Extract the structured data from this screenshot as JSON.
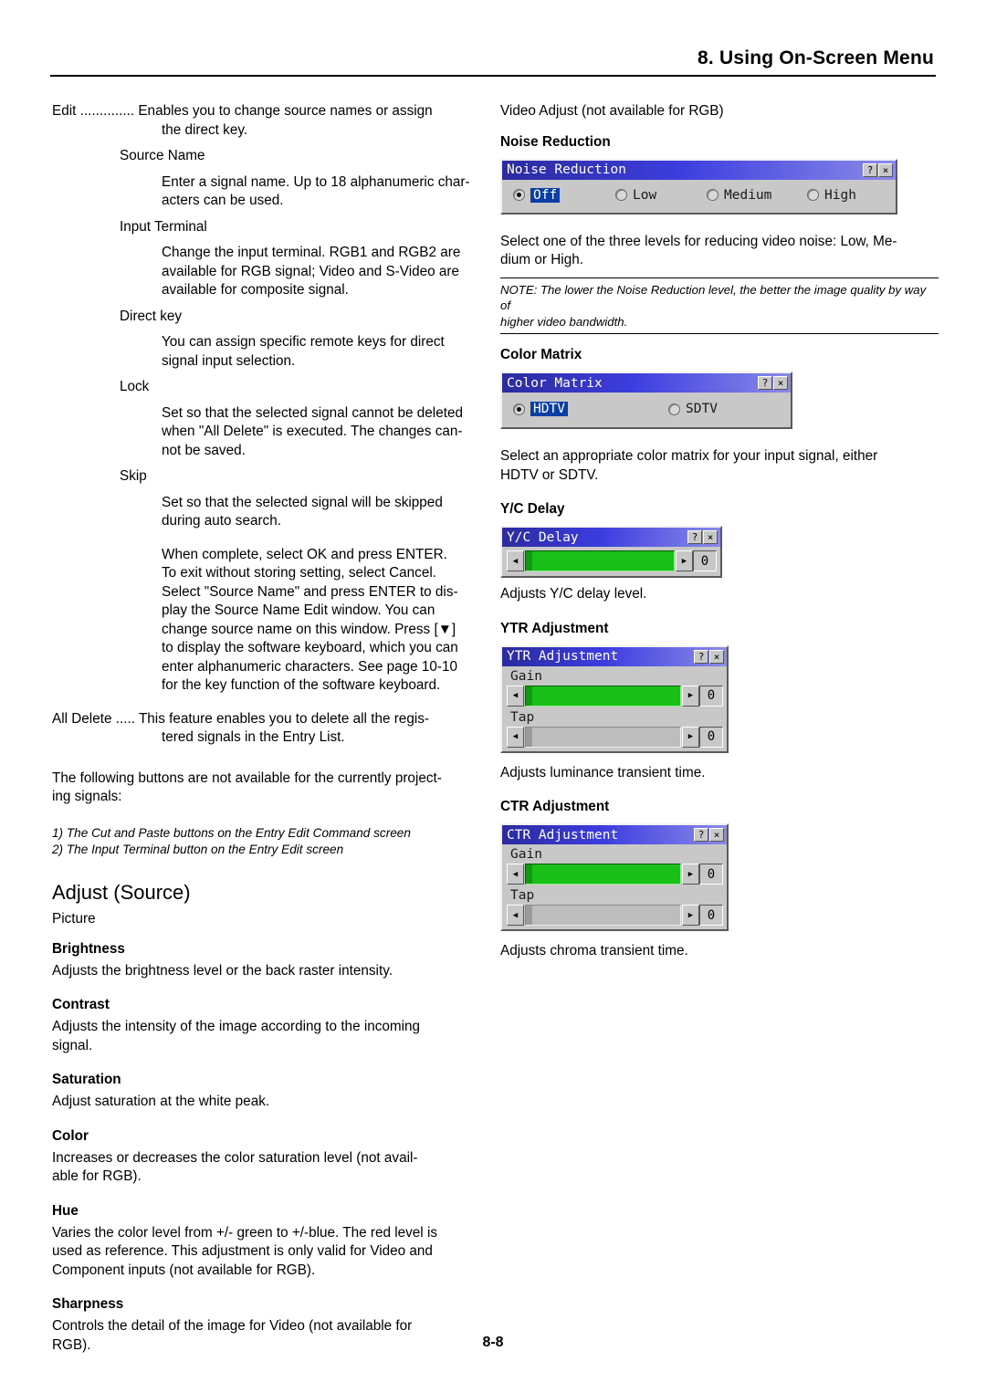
{
  "header": {
    "title": "8. Using On-Screen Menu"
  },
  "footer": {
    "page_number": "8-8"
  },
  "left": {
    "edit_label": "Edit .............. Enables you to change source names or assign",
    "edit_label_2": "the direct key.",
    "source_name_head": "Source Name",
    "source_name_body_1": "Enter a signal name. Up to 18 alphanumeric char-",
    "source_name_body_2": "acters can be used.",
    "input_terminal_head": "Input Terminal",
    "input_terminal_body_1": "Change the input terminal. RGB1 and RGB2 are",
    "input_terminal_body_2": "available for RGB signal; Video and S-Video are",
    "input_terminal_body_3": "available for composite signal.",
    "direct_key_head": "Direct key",
    "direct_key_body_1": "You can assign specific remote keys for direct",
    "direct_key_body_2": "signal input selection.",
    "lock_head": "Lock",
    "lock_body_1": "Set so that the selected signal cannot be deleted",
    "lock_body_2": "when \"All Delete\" is executed. The changes can-",
    "lock_body_3": "not be saved.",
    "skip_head": "Skip",
    "skip_body_1": "Set so that the selected signal will be skipped",
    "skip_body_2": "during auto search.",
    "complete_1": "When complete, select OK and press ENTER.",
    "complete_2": "To exit without storing setting, select Cancel.",
    "complete_3": "Select \"Source Name\" and press ENTER to dis-",
    "complete_4": "play the Source Name Edit window. You can",
    "complete_5": "change source name on this window. Press [▼]",
    "complete_6": "to display the software keyboard, which you can",
    "complete_7": "enter alphanumeric characters. See page 10-10",
    "complete_8": "for the key function of the software keyboard.",
    "all_delete_1": "All Delete ..... This feature enables you to delete all the regis-",
    "all_delete_2": "tered signals in the Entry List.",
    "not_available_1": "The following buttons are not available for the currently project-",
    "not_available_2": "ing signals:",
    "note_1": "1) The Cut and Paste buttons on the Entry Edit Command screen",
    "note_2": "2) The Input Terminal button on the Entry Edit screen",
    "adjust_source_heading": "Adjust (Source)",
    "picture_label": "Picture",
    "items": [
      {
        "title": "Brightness",
        "lines": [
          "Adjusts the brightness level or the back raster intensity."
        ]
      },
      {
        "title": "Contrast",
        "lines": [
          "Adjusts the intensity of the image according to the incoming",
          "signal."
        ]
      },
      {
        "title": "Saturation",
        "lines": [
          "Adjust saturation at the white peak."
        ]
      },
      {
        "title": "Color",
        "lines": [
          "Increases or decreases the color saturation level (not avail-",
          "able for RGB)."
        ]
      },
      {
        "title": "Hue",
        "lines": [
          "Varies the color level from +/- green to +/-blue. The red level is",
          "used as reference. This adjustment is only valid for Video and",
          "Component inputs (not available for RGB)."
        ]
      },
      {
        "title": "Sharpness",
        "lines": [
          "Controls the detail of the image for Video (not available for",
          "RGB)."
        ]
      }
    ]
  },
  "right": {
    "video_adjust_label": "Video Adjust (not available for RGB)",
    "noise_reduction": {
      "heading": "Noise Reduction",
      "dialog_title": "Noise Reduction",
      "help_btn": "?",
      "close_btn": "×",
      "options": [
        {
          "label": "Off",
          "selected": true
        },
        {
          "label": "Low",
          "selected": false
        },
        {
          "label": "Medium",
          "selected": false
        },
        {
          "label": "High",
          "selected": false
        }
      ],
      "desc_1": "Select one of the three levels for reducing video noise: Low, Me-",
      "desc_2": "dium or High.",
      "note_1": "NOTE: The lower the Noise Reduction level, the better the image quality by way of",
      "note_2": "higher video bandwidth."
    },
    "color_matrix": {
      "heading": "Color Matrix",
      "dialog_title": "Color Matrix",
      "help_btn": "?",
      "close_btn": "×",
      "options": [
        {
          "label": "HDTV",
          "selected": true
        },
        {
          "label": "SDTV",
          "selected": false
        }
      ],
      "desc_1": "Select an appropriate color matrix for your input signal, either",
      "desc_2": "HDTV or SDTV."
    },
    "yc_delay": {
      "heading": "Y/C Delay",
      "dialog_title": "Y/C Delay",
      "help_btn": "?",
      "close_btn": "×",
      "left_arrow": "◀",
      "right_arrow": "▶",
      "value": "0",
      "desc": "Adjusts Y/C delay level."
    },
    "ytr_adjustment": {
      "heading": "YTR Adjustment",
      "dialog_title": "YTR Adjustment",
      "help_btn": "?",
      "close_btn": "×",
      "gain_label": "Gain",
      "gain_value": "0",
      "tap_label": "Tap",
      "tap_value": "0",
      "left_arrow": "◀",
      "right_arrow": "▶",
      "desc": "Adjusts luminance transient time."
    },
    "ctr_adjustment": {
      "heading": "CTR Adjustment",
      "dialog_title": "CTR Adjustment",
      "help_btn": "?",
      "close_btn": "×",
      "gain_label": "Gain",
      "gain_value": "0",
      "tap_label": "Tap",
      "tap_value": "0",
      "left_arrow": "◀",
      "right_arrow": "▶",
      "desc": "Adjusts chroma transient time."
    }
  }
}
